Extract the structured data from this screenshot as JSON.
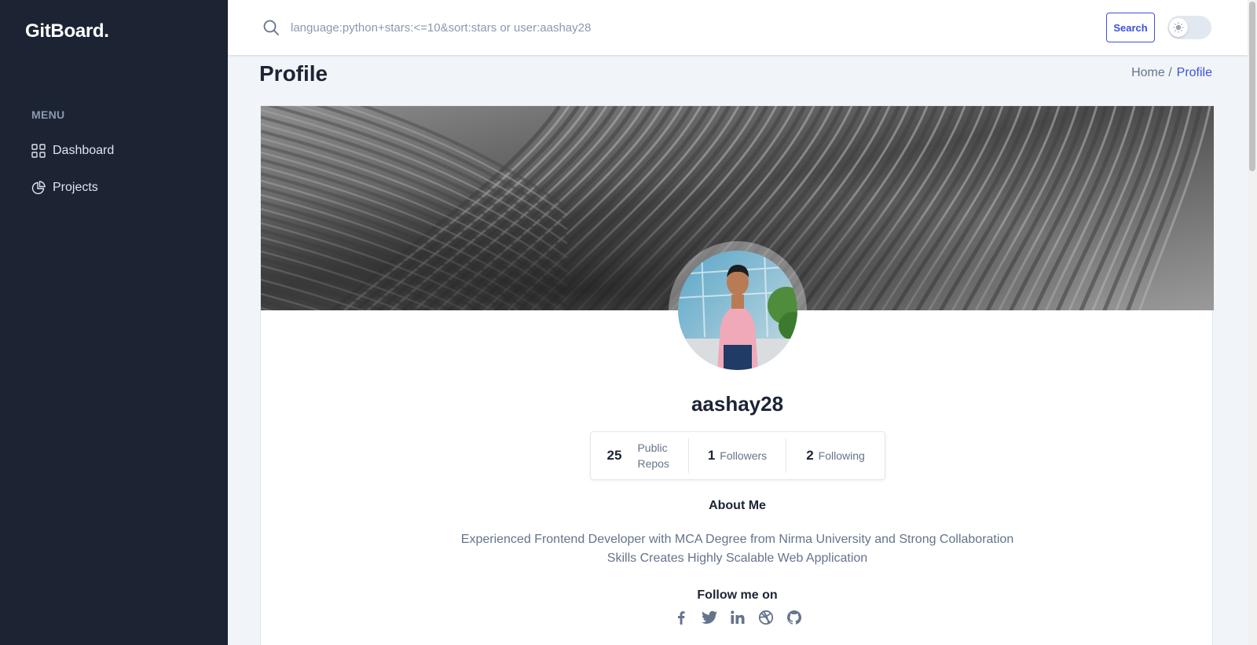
{
  "app": {
    "logo": "GitBoard."
  },
  "sidebar": {
    "menu_title": "MENU",
    "items": [
      {
        "label": "Dashboard",
        "icon": "grid-icon"
      },
      {
        "label": "Projects",
        "icon": "pie-chart-icon"
      }
    ]
  },
  "header": {
    "search": {
      "placeholder": "language:python+stars:<=10&sort:stars or user:aashay28",
      "value": ""
    },
    "search_button": "Search",
    "theme_toggle": {
      "icon": "sun-icon",
      "state": "light"
    }
  },
  "page": {
    "title": "Profile",
    "breadcrumb": {
      "home": "Home /",
      "current": "Profile"
    }
  },
  "profile": {
    "username": "aashay28",
    "stats": {
      "repos": {
        "value": "25",
        "label": "Public Repos"
      },
      "followers": {
        "value": "1",
        "label": "Followers"
      },
      "following": {
        "value": "2",
        "label": "Following"
      }
    },
    "about_title": "About Me",
    "about_text": "Experienced Frontend Developer with MCA Degree from Nirma University and Strong Collaboration Skills Creates Highly Scalable Web Application",
    "follow_title": "Follow me on",
    "socials": [
      "facebook-icon",
      "twitter-icon",
      "linkedin-icon",
      "dribbble-icon",
      "github-icon"
    ]
  },
  "colors": {
    "sidebar_bg": "#1c2434",
    "accent": "#3c50e0",
    "page_bg": "#f1f5f9",
    "muted_text": "#64748b"
  }
}
